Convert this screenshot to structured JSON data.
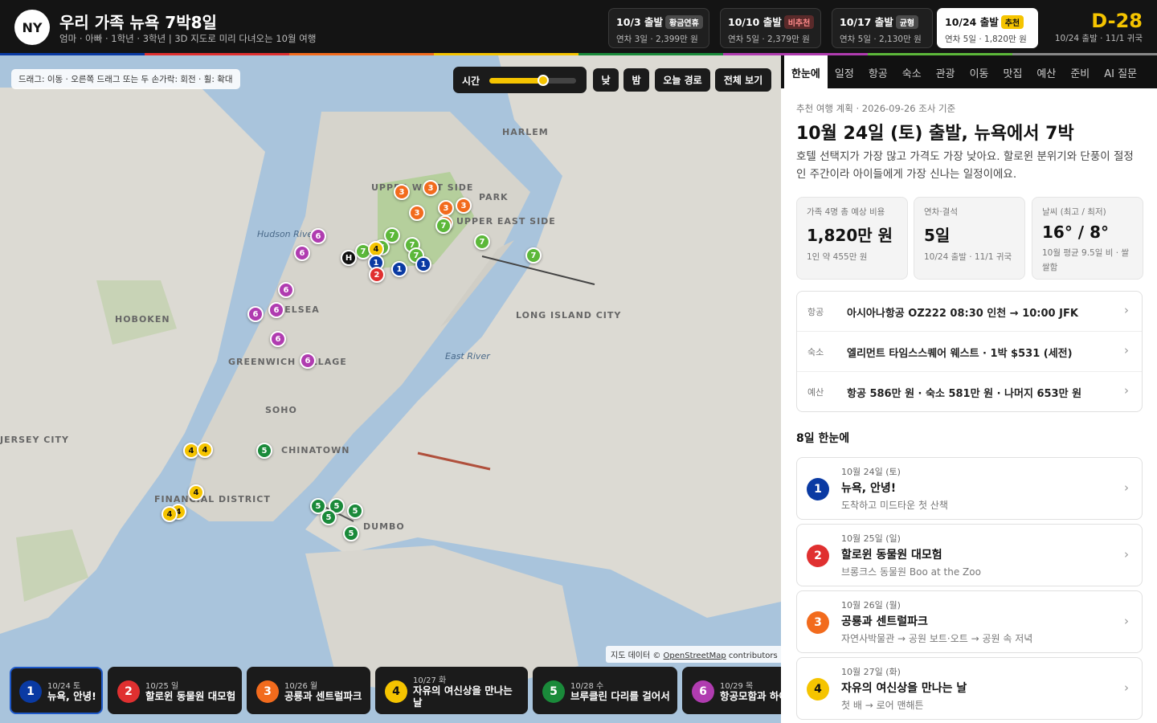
{
  "header": {
    "logo": "NY",
    "title": "우리 가족 뉴욕 7박8일",
    "subtitle": "엄마 · 아빠 · 1학년 · 3학년 | 3D 지도로 미리 다녀오는 10월 여행",
    "departures": [
      {
        "date": "10/3 출발",
        "badge": "황금연휴",
        "info": "연차 3일 · 2,399만 원",
        "badge_color": "#4a4a4a",
        "badge_text_color": "#ffffff",
        "selected": false
      },
      {
        "date": "10/10 출발",
        "badge": "비추천",
        "info": "연차 5일 · 2,379만 원",
        "badge_color": "#5a2a2a",
        "badge_text_color": "#ff8a8a",
        "selected": false
      },
      {
        "date": "10/17 출발",
        "badge": "균형",
        "info": "연차 5일 · 2,130만 원",
        "badge_color": "#4a4a4a",
        "badge_text_color": "#ffffff",
        "selected": false
      },
      {
        "date": "10/24 출발",
        "badge": "추천",
        "info": "연차 5일 · 1,820만 원",
        "badge_color": "#f5c400",
        "badge_text_color": "#111111",
        "selected": true
      }
    ],
    "dday": "D-28",
    "dday_sub": "10/24 출발 · 11/1 귀국"
  },
  "map": {
    "hint": "드래그: 이동 · 오른쪽 드래그 또는 두 손가락: 회전 · 휠: 확대",
    "time_label": "시간",
    "time_level": 0.62,
    "buttons": {
      "day": "낮",
      "night": "밤",
      "today_route": "오늘 경로",
      "view_all": "전체 보기"
    },
    "place_labels": [
      "HARLEM",
      "UPPER WEST SIDE",
      "PARK",
      "UPPER EAST SIDE",
      "Hudson River",
      "CHELSEA",
      "LONG ISLAND CITY",
      "HOBOKEN",
      "East River",
      "GREENWICH VILLAGE",
      "SOHO",
      "JERSEY CITY",
      "CHINATOWN",
      "FINANCIAL DISTRICT",
      "DUMBO"
    ],
    "attribution_prefix": "지도 데이터 © ",
    "attribution_link": "OpenStreetMap",
    "attribution_suffix": " contributors",
    "hotel_marker": "H"
  },
  "colors": {
    "day1": "#0a3aa3",
    "day2": "#e03030",
    "day3": "#f26b1d",
    "day4": "#f5c400",
    "day5": "#1a8a3a",
    "day6": "#b03cb0",
    "day7": "#5cb83a",
    "water": "#a9c4dc",
    "land": "#dcdad3",
    "park": "#b5cf9c",
    "accent": "#f5c400"
  },
  "days": [
    {
      "num": "1",
      "short": "10/24 토",
      "date": "10월 24일 (토)",
      "title": "뉴욕, 안녕!",
      "sub": "도착하고 미드타운 첫 산책"
    },
    {
      "num": "2",
      "short": "10/25 일",
      "date": "10월 25일 (일)",
      "title": "할로윈 동물원 대모험",
      "sub": "브롱크스 동물원 Boo at the Zoo"
    },
    {
      "num": "3",
      "short": "10/26 월",
      "date": "10월 26일 (월)",
      "title": "공룡과 센트럴파크",
      "sub": "자연사박물관 → 공원 보트·오트 → 공원 속 저녁"
    },
    {
      "num": "4",
      "short": "10/27 화",
      "date": "10월 27일 (화)",
      "title": "자유의 여신상을 만나는 날",
      "sub": "첫 배 → 로어 맨해튼"
    },
    {
      "num": "5",
      "short": "10/28 수",
      "title": "브루클린 다리를 걸어서"
    },
    {
      "num": "6",
      "short": "10/29 목",
      "title": "항공모함과 하이라인"
    }
  ],
  "panel": {
    "tabs": [
      "한눈에",
      "일정",
      "항공",
      "숙소",
      "관광",
      "이동",
      "맛집",
      "예산",
      "준비",
      "AI 질문"
    ],
    "meta": "추천 여행 계획 · 2026-09-26 조사 기준",
    "title": "10월 24일 (토) 출발, 뉴욕에서 7박",
    "desc": "호텔 선택지가 가장 많고 가격도 가장 낮아요. 할로윈 분위기와 단풍이 절정인 주간이라 아이들에게 가장 신나는 일정이에요.",
    "stats": [
      {
        "label": "가족 4명 총 예상 비용",
        "value": "1,820만 원",
        "sub": "1인 약 455만 원"
      },
      {
        "label": "연차·결석",
        "value": "5일",
        "sub": "10/24 출발 · 11/1 귀국"
      },
      {
        "label": "날씨 (최고 / 최저)",
        "value": "16° / 8°",
        "sub": "10월 평균 9.5일 비 · 쌀쌀함"
      }
    ],
    "info_rows": [
      {
        "key": "항공",
        "value": "아시아나항공 OZ222 08:30 인천 → 10:00 JFK"
      },
      {
        "key": "숙소",
        "value": "엘리먼트 타임스스퀘어 웨스트 · 1박 $531 (세전)"
      },
      {
        "key": "예산",
        "value": "항공 586만 원 · 숙소 581만 원 · 나머지 653만 원"
      }
    ],
    "section_title": "8일 한눈에",
    "chevron": "›"
  }
}
